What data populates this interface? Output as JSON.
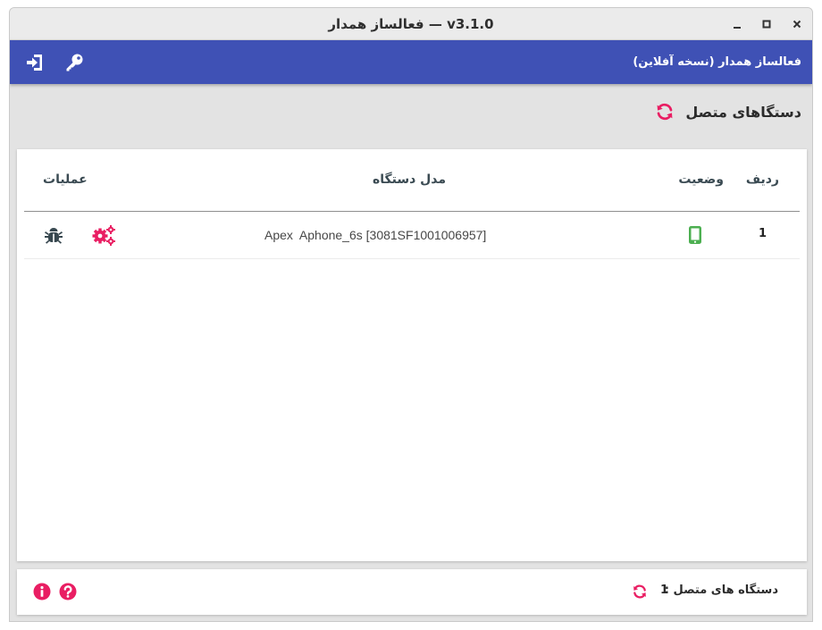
{
  "window": {
    "title": "فعالساز همدار — v3.1.0",
    "controls": [
      "minimize",
      "maximize",
      "close"
    ]
  },
  "appbar": {
    "title": "فعالساز همدار (نسخه آفلاین)",
    "icons": [
      "login-icon",
      "key-icon"
    ]
  },
  "section": {
    "title": "دستگاهای متصل"
  },
  "table": {
    "columns": {
      "row": "ردیف",
      "status": "وضعیت",
      "model": "مدل دستگاه",
      "ops": "عملیات"
    },
    "rows": [
      {
        "index": "1",
        "status": "connected-phone",
        "model": "Apex  Aphone_6s [3081SF1001006957]"
      }
    ]
  },
  "footer": {
    "label": "دستگاه های متصل :",
    "count": "1"
  },
  "colors": {
    "primary": "#3f51b5",
    "accent": "#e91e63",
    "status_ok": "#4caf50",
    "dark_icon": "#37474f"
  }
}
